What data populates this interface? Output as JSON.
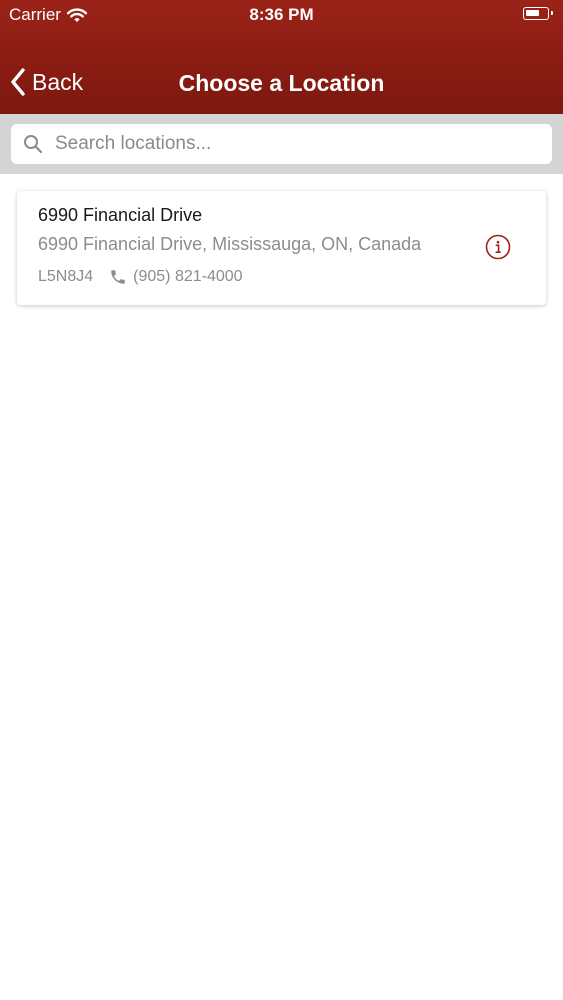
{
  "status_bar": {
    "carrier": "Carrier",
    "time": "8:36 PM"
  },
  "nav": {
    "back_label": "Back",
    "title": "Choose a Location"
  },
  "search": {
    "placeholder": "Search locations...",
    "value": ""
  },
  "locations": [
    {
      "name": "6990 Financial Drive",
      "address": "6990 Financial Drive, Mississauga, ON, Canada",
      "postal_code": "L5N8J4",
      "phone": "(905) 821-4000"
    }
  ],
  "colors": {
    "brand_red": "#8a1c12",
    "search_strip": "#d4d4d4",
    "muted_text": "#8c8c8c"
  },
  "icons": {
    "back": "chevron-left-icon",
    "search": "search-icon",
    "phone": "phone-icon",
    "info": "info-icon",
    "wifi": "wifi-icon",
    "battery": "battery-icon"
  }
}
